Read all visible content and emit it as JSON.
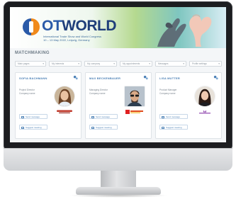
{
  "banner": {
    "logo_prefix": "OT",
    "logo_suffix": "WORLD",
    "tagline": "International Trade Show and World Congress",
    "dates": "10 – 13 May 2022, Leipzig, Germany"
  },
  "section_title": "MATCHMAKING",
  "filters": [
    {
      "label": "Main pages"
    },
    {
      "label": "My interests"
    },
    {
      "label": "My company"
    },
    {
      "label": "My appointments"
    },
    {
      "label": "Messages"
    },
    {
      "label": "Profile settings"
    }
  ],
  "cards": [
    {
      "name": "SOFIA BACHMANN",
      "role": "Project Director",
      "company": "Company name",
      "message_label": "Send message",
      "meeting_label": "Suggest meeting",
      "logo_color": "#c0392b"
    },
    {
      "name": "MAX BECKENBAUER",
      "role": "Managing Director",
      "company": "Company name",
      "message_label": "Send message",
      "meeting_label": "Suggest meeting",
      "logo_color": "#e04a1a"
    },
    {
      "name": "LISA MUTTER",
      "role": "Product Manager",
      "company": "Company name",
      "message_label": "Send message",
      "meeting_label": "Suggest meeting",
      "logo_color": "#8e44ad"
    }
  ],
  "colors": {
    "accent": "#4a7fb5",
    "brand_blue": "#2a5aa8",
    "brand_orange": "#f08a1c"
  }
}
